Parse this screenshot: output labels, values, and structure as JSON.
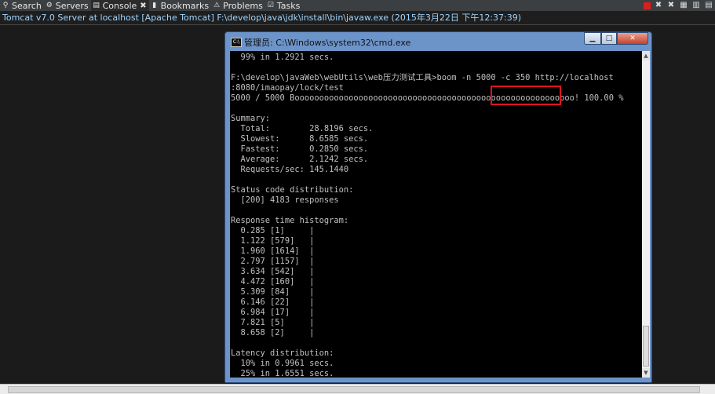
{
  "tabs": [
    {
      "label": "Search",
      "icon": "search-icon"
    },
    {
      "label": "Servers",
      "icon": "servers-icon"
    },
    {
      "label": "Console",
      "icon": "console-icon",
      "active": true
    },
    {
      "label": "Bookmarks",
      "icon": "bookmark-icon"
    },
    {
      "label": "Problems",
      "icon": "problems-icon"
    },
    {
      "label": "Tasks",
      "icon": "tasks-icon"
    }
  ],
  "console_title": "Tomcat v7.0 Server at localhost [Apache Tomcat] F:\\develop\\java\\jdk\\install\\bin\\javaw.exe (2015年3月22日 下午12:37:39)",
  "cmd": {
    "title": "管理员: C:\\Windows\\system32\\cmd.exe",
    "icon_text": "C:\\",
    "lines": [
      "  99% in 1.2921 secs.",
      "",
      "F:\\develop\\javaWeb\\webUtils\\web压力测试工具>boom -n 5000 -c 350 http://localhost",
      ":8080/imaopay/lock/test",
      "5000 / 5000 Booooooooooooooooooooooooooooooooooooooooooooooooooooooooo! 100.00 %",
      "",
      "Summary:",
      "  Total:        28.8196 secs.",
      "  Slowest:      8.6585 secs.",
      "  Fastest:      0.2850 secs.",
      "  Average:      2.1242 secs.",
      "  Requests/sec: 145.1440",
      "",
      "Status code distribution:",
      "  [200] 4183 responses",
      "",
      "Response time histogram:",
      "  0.285 [1]     |",
      "  1.122 [579]   |",
      "  1.960 [1614]  |",
      "  2.797 [1157]  |",
      "  3.634 [542]   |",
      "  4.472 [160]   |",
      "  5.309 [84]    |",
      "  6.146 [22]    |",
      "  6.984 [17]    |",
      "  7.821 [5]     |",
      "  8.658 [2]     |",
      "",
      "Latency distribution:",
      "  10% in 0.9961 secs.",
      "  25% in 1.6551 secs."
    ]
  }
}
